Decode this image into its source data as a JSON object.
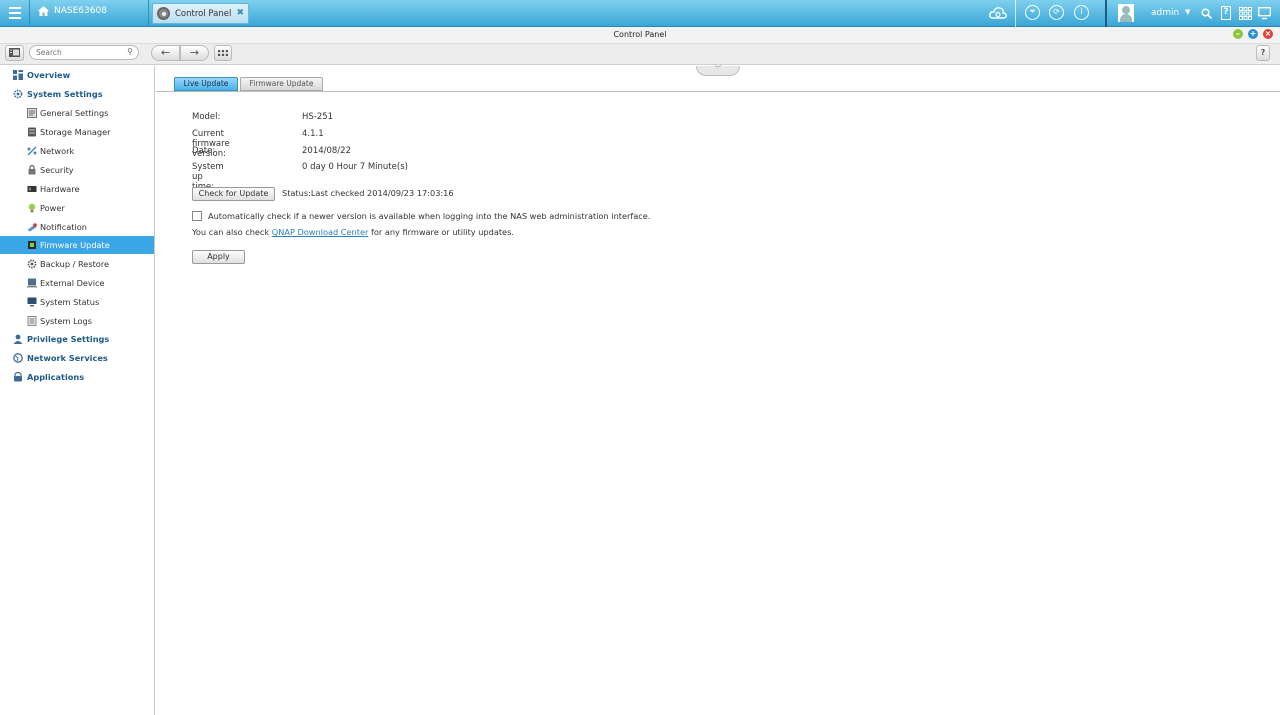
{
  "topbar": {
    "nas_name": "NASE63608",
    "open_tab_label": "Control Panel",
    "user_name": "admin"
  },
  "window": {
    "title": "Control Panel"
  },
  "toolbar": {
    "search_placeholder": "Search"
  },
  "sidebar": {
    "sections": [
      {
        "label": "Overview"
      },
      {
        "label": "System Settings"
      },
      {
        "label": "Privilege Settings"
      },
      {
        "label": "Network Services"
      },
      {
        "label": "Applications"
      }
    ],
    "items": [
      {
        "label": "General Settings"
      },
      {
        "label": "Storage Manager"
      },
      {
        "label": "Network"
      },
      {
        "label": "Security"
      },
      {
        "label": "Hardware"
      },
      {
        "label": "Power"
      },
      {
        "label": "Notification"
      },
      {
        "label": "Firmware Update"
      },
      {
        "label": "Backup / Restore"
      },
      {
        "label": "External Device"
      },
      {
        "label": "System Status"
      },
      {
        "label": "System Logs"
      }
    ],
    "active_item": "Firmware Update"
  },
  "tabs": {
    "live_update": "Live Update",
    "firmware_update": "Firmware Update"
  },
  "info": {
    "model_label": "Model:",
    "model_value": "HS-251",
    "fw_label": "Current firmware version:",
    "fw_value": "4.1.1",
    "date_label": "Date:",
    "date_value": "2014/08/22",
    "uptime_label": "System up time:",
    "uptime_value": "0 day 0 Hour 7 Minute(s)"
  },
  "actions": {
    "check_button": "Check for Update",
    "status_text": "Status:Last checked 2014/09/23 17:03:16",
    "auto_check_label": "Automatically check if a newer version is available when logging into the NAS web administration interface.",
    "auto_check_checked": false,
    "also_prefix": "You can also check",
    "download_link": "QNAP Download Center",
    "also_suffix": "for any firmware or utility updates.",
    "apply_button": "Apply"
  },
  "colors": {
    "topbar": "#3aa6d6",
    "active_item": "#3aa6e6",
    "link": "#2a7fc0",
    "section_label": "#1f5b8a"
  }
}
